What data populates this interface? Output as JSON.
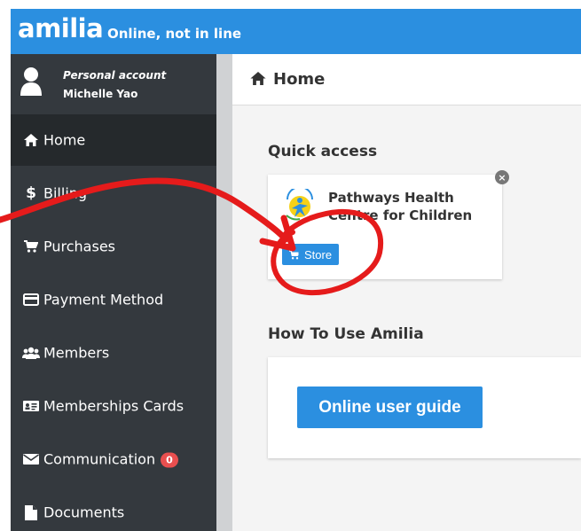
{
  "app": {
    "logo": "amilia",
    "tagline": "Online, not in line"
  },
  "account": {
    "type": "Personal account",
    "name": "Michelle Yao"
  },
  "sidebar": {
    "items": [
      {
        "label": "Home",
        "icon": "home-icon",
        "active": true
      },
      {
        "label": "Billing",
        "icon": "dollar-icon"
      },
      {
        "label": "Purchases",
        "icon": "cart-icon"
      },
      {
        "label": "Payment Method",
        "icon": "credit-card-icon"
      },
      {
        "label": "Members",
        "icon": "users-icon"
      },
      {
        "label": "Memberships Cards",
        "icon": "id-card-icon"
      },
      {
        "label": "Communication",
        "icon": "envelope-icon",
        "badge": "0"
      },
      {
        "label": "Documents",
        "icon": "file-icon"
      }
    ]
  },
  "header": {
    "title": "Home",
    "icon": "home-icon"
  },
  "quick_access": {
    "title": "Quick access",
    "card": {
      "title": "Pathways Health Centre for Children",
      "store_label": "Store",
      "close_label": "×"
    }
  },
  "how_to": {
    "title": "How To Use Amilia",
    "button_label": "Online user guide"
  },
  "colors": {
    "brand": "#2b8fe0",
    "sidebar": "#34393e",
    "sidebar_active": "#25292c",
    "badge": "#e94f4f",
    "annotation": "#e51b1b"
  }
}
